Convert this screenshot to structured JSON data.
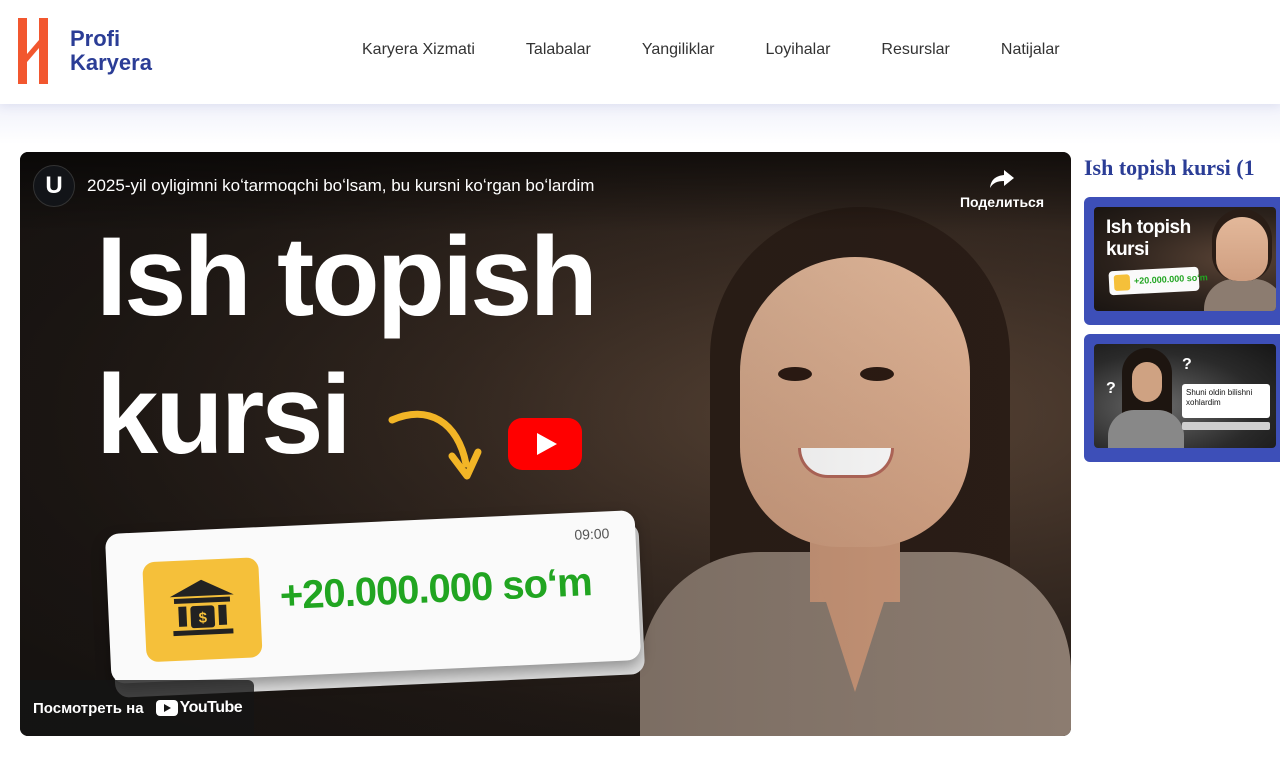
{
  "brand": {
    "line1": "Profi",
    "line2": "Karyera"
  },
  "nav": [
    "Karyera Xizmati",
    "Talabalar",
    "Yangiliklar",
    "Loyihalar",
    "Resurslar",
    "Natijalar"
  ],
  "video": {
    "channel_initial": "U",
    "title": "2025-yil oyligimni koʻtarmoqchi boʻlsam, bu kursni koʻrgan boʻlardim",
    "share_label": "Поделиться",
    "headline_line1": "Ish topish",
    "headline_line2": "kursi",
    "card_time": "09:00",
    "card_amount": "+20.000.000 soʻm",
    "watch_on": "Посмотреть на",
    "watch_brand": "YouTube"
  },
  "sidebar": {
    "title": "Ish topish kursi (1",
    "thumbnails": [
      {
        "title_line1": "Ish topish",
        "title_line2": "kursi",
        "amount": "+20.000.000 soʻm"
      },
      {
        "bubble_text": "Shuni oldin bilishni xohlardim",
        "mark": "?"
      }
    ]
  },
  "colors": {
    "brand_blue": "#2b3d96",
    "logo_orange": "#f2572f",
    "youtube_red": "#ff0000",
    "amount_green": "#21a521",
    "bank_yellow": "#f5c03a",
    "sidebar_box": "#3d4fb8"
  }
}
